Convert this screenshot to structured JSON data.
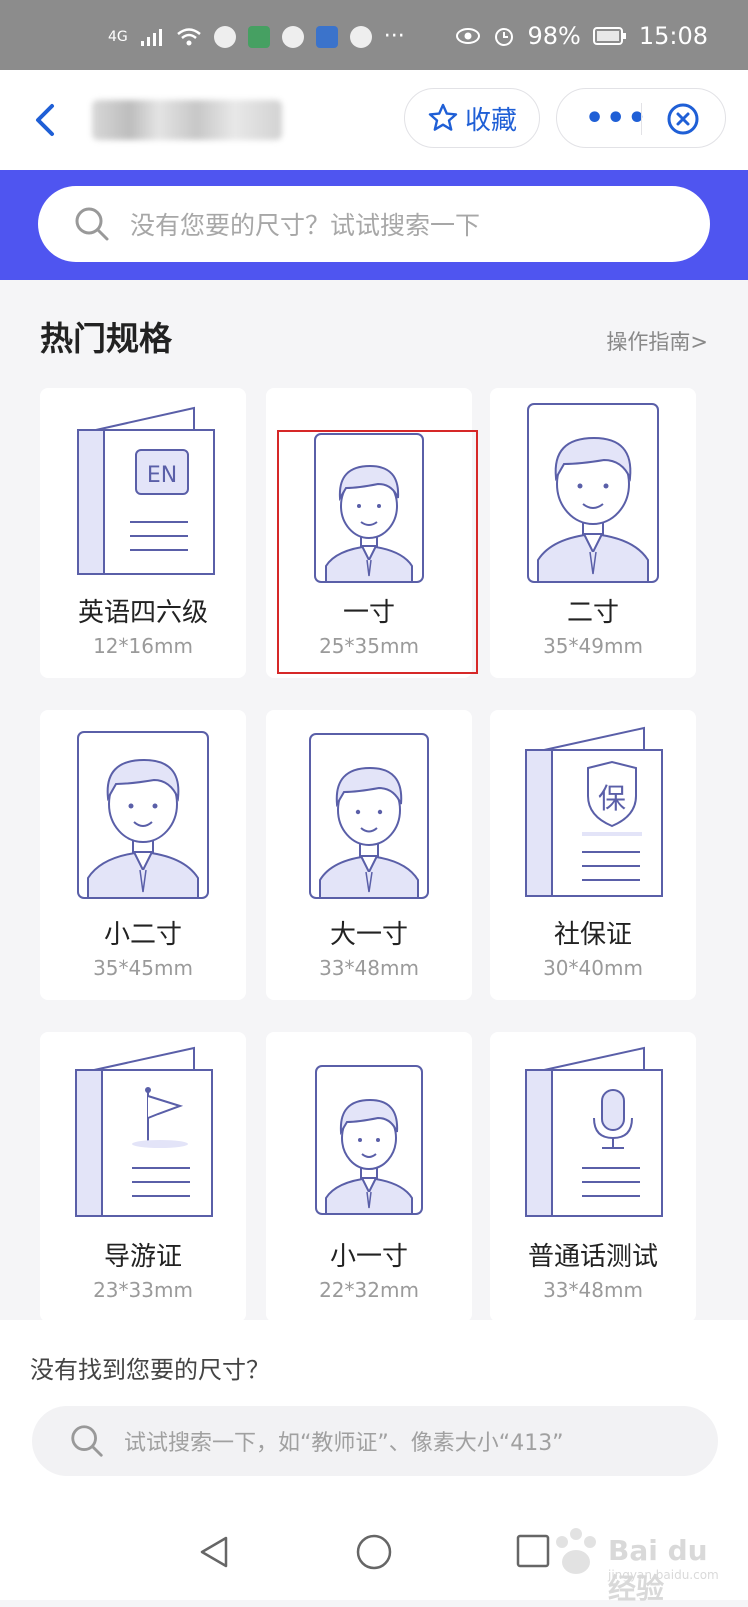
{
  "status_bar": {
    "network": "4G",
    "battery": "98%",
    "time": "15:08"
  },
  "header": {
    "favorite_label": "收藏"
  },
  "search": {
    "top_placeholder": "没有您要的尺寸？试试搜索一下",
    "bottom_prompt": "没有找到您要的尺寸？",
    "bottom_placeholder": "试试搜索一下，如“教师证”、像素大小“413”"
  },
  "section": {
    "title": "热门规格",
    "guide_link": "操作指南>"
  },
  "specs": [
    {
      "name": "英语四六级",
      "size": "12*16mm",
      "icon": "book-en-icon",
      "icon_text": "EN"
    },
    {
      "name": "一寸",
      "size": "25*35mm",
      "icon": "portrait-small-icon",
      "highlighted": true
    },
    {
      "name": "二寸",
      "size": "35*49mm",
      "icon": "portrait-large-icon"
    },
    {
      "name": "小二寸",
      "size": "35*45mm",
      "icon": "portrait-large-icon"
    },
    {
      "name": "大一寸",
      "size": "33*48mm",
      "icon": "portrait-medium-icon"
    },
    {
      "name": "社保证",
      "size": "30*40mm",
      "icon": "book-shield-icon",
      "icon_text": "保"
    },
    {
      "name": "导游证",
      "size": "23*33mm",
      "icon": "book-flag-icon"
    },
    {
      "name": "小一寸",
      "size": "22*32mm",
      "icon": "portrait-small-icon"
    },
    {
      "name": "普通话测试",
      "size": "33*48mm",
      "icon": "book-mic-icon"
    }
  ],
  "watermark": {
    "text": "Bai du 经验",
    "sub": "jingyan.baidu.com"
  },
  "colors": {
    "accent": "#1f5fd6",
    "banner": "#4f55f0",
    "illustration": "#5a5fa8",
    "illustration_fill": "#e3e4f8",
    "highlight": "#d62828"
  }
}
